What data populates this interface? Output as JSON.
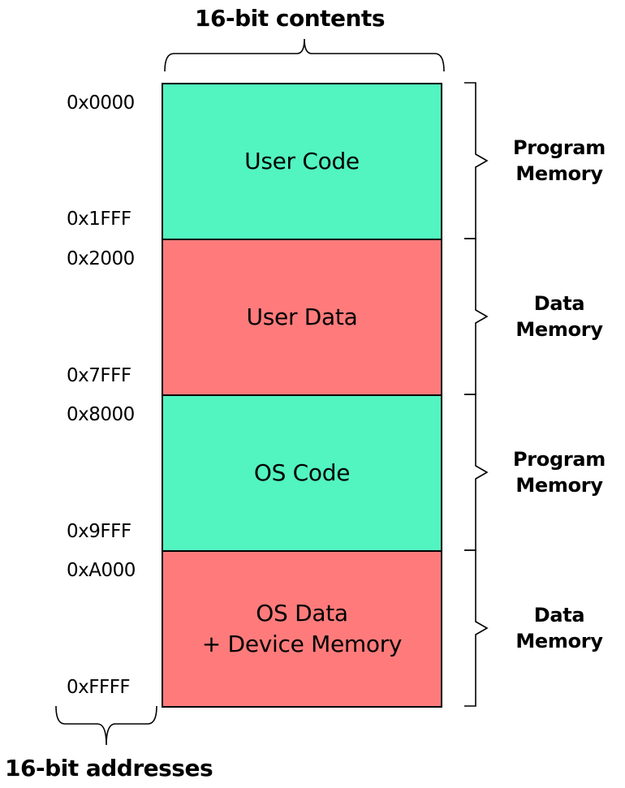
{
  "header": {
    "contents_title": "16-bit contents",
    "addresses_title": "16-bit addresses"
  },
  "colors": {
    "code": "#52f4c0",
    "data": "#ff7b7b",
    "border": "#000000"
  },
  "blocks": [
    {
      "lines": [
        "User Code"
      ],
      "kind": "code",
      "start": "0x0000",
      "end": "0x1FFF",
      "region": [
        "Program",
        "Memory"
      ]
    },
    {
      "lines": [
        "User Data"
      ],
      "kind": "data",
      "start": "0x2000",
      "end": "0x7FFF",
      "region": [
        "Data",
        "Memory"
      ]
    },
    {
      "lines": [
        "OS Code"
      ],
      "kind": "code",
      "start": "0x8000",
      "end": "0x9FFF",
      "region": [
        "Program",
        "Memory"
      ]
    },
    {
      "lines": [
        "OS Data",
        "+ Device Memory"
      ],
      "kind": "data",
      "start": "0xA000",
      "end": "0xFFFF",
      "region": [
        "Data",
        "Memory"
      ]
    }
  ]
}
